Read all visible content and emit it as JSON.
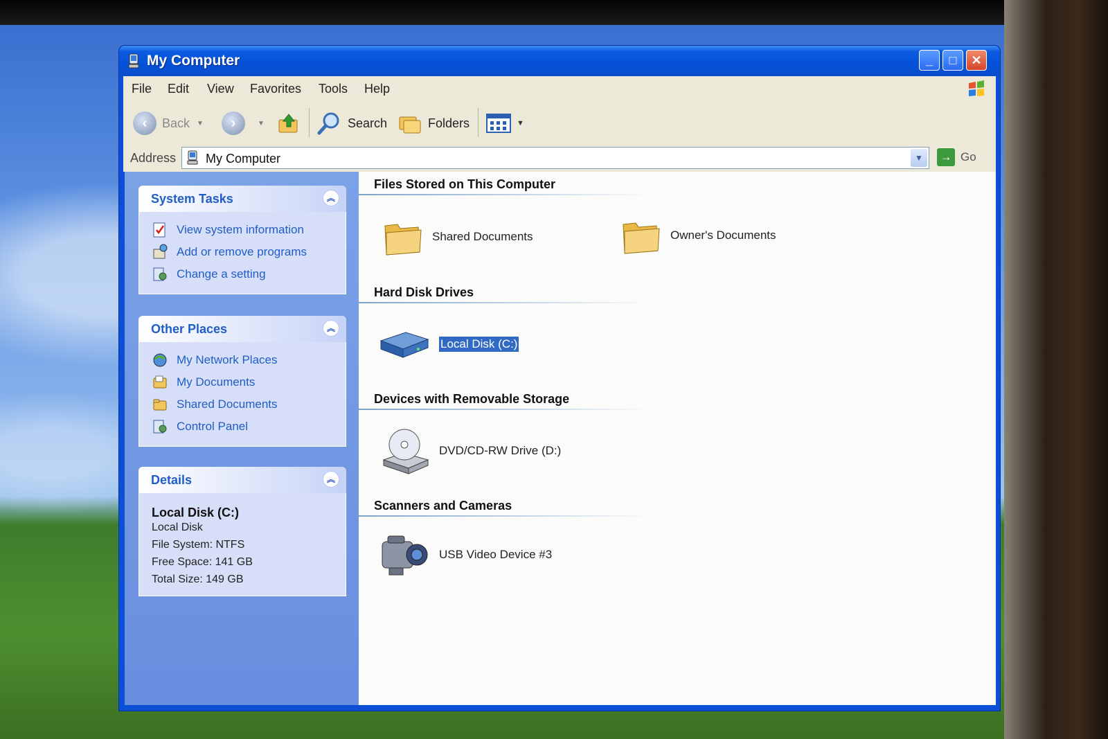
{
  "window": {
    "title": "My Computer"
  },
  "menubar": {
    "items": [
      "File",
      "Edit",
      "View",
      "Favorites",
      "Tools",
      "Help"
    ]
  },
  "toolbar": {
    "back_label": "Back",
    "search_label": "Search",
    "folders_label": "Folders",
    "icons": [
      "back-arrow-icon",
      "forward-arrow-icon",
      "up-folder-icon",
      "search-magnifier-icon",
      "folders-icon",
      "views-icon"
    ]
  },
  "address": {
    "label": "Address",
    "value": "My Computer",
    "go_label": "Go"
  },
  "system_tasks": {
    "title": "System Tasks",
    "items": [
      {
        "label": "View system information",
        "icon": "system-info-icon"
      },
      {
        "label": "Add or remove programs",
        "icon": "add-remove-programs-icon"
      },
      {
        "label": "Change a setting",
        "icon": "control-panel-icon"
      }
    ]
  },
  "other_places": {
    "title": "Other Places",
    "items": [
      {
        "label": "My Network Places",
        "icon": "network-places-icon"
      },
      {
        "label": "My Documents",
        "icon": "my-documents-icon"
      },
      {
        "label": "Shared Documents",
        "icon": "folder-icon"
      },
      {
        "label": "Control Panel",
        "icon": "control-panel-icon"
      }
    ]
  },
  "details": {
    "title": "Details",
    "name": "Local Disk (C:)",
    "type": "Local Disk",
    "file_system": "File System: NTFS",
    "free_space": "Free Space: 141 GB",
    "total_size": "Total Size: 149 GB"
  },
  "groups": {
    "files": {
      "title": "Files Stored on This Computer",
      "items": [
        "Shared Documents",
        "Owner's Documents"
      ]
    },
    "hard_disks": {
      "title": "Hard Disk Drives",
      "items": [
        "Local Disk (C:)"
      ]
    },
    "removable": {
      "title": "Devices with Removable Storage",
      "items": [
        "DVD/CD-RW Drive (D:)"
      ]
    },
    "scanners": {
      "title": "Scanners and Cameras",
      "items": [
        "USB Video Device #3"
      ]
    }
  },
  "colors": {
    "titlebar_blue": "#0551d8",
    "taskpane_blue": "#7ba2e7",
    "link_blue": "#215dc6",
    "selection_blue": "#316ac5"
  }
}
